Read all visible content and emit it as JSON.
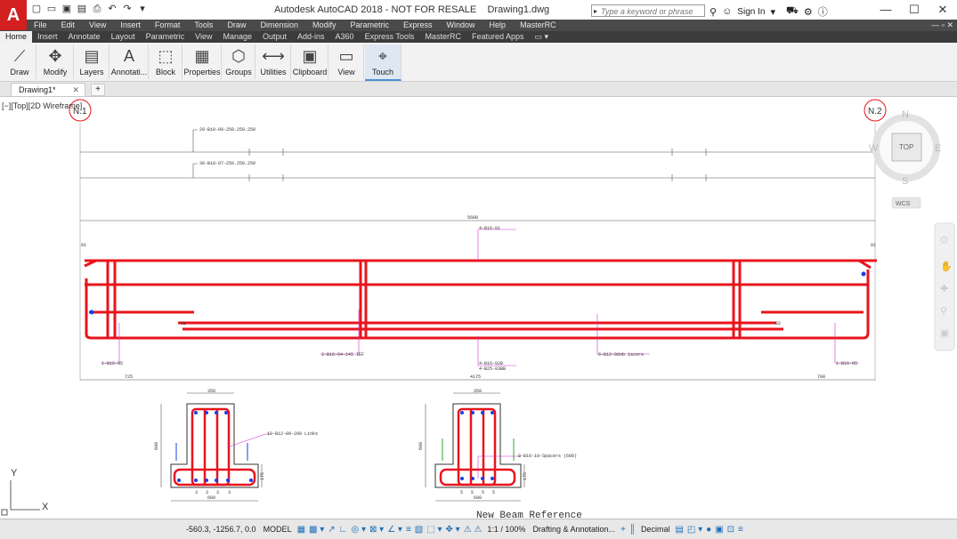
{
  "app": {
    "logo": "A",
    "title": "Autodesk AutoCAD 2018 - NOT FOR RESALE",
    "filename": "Drawing1.dwg"
  },
  "search": {
    "placeholder": "Type a keyword or phrase",
    "signin": "Sign In"
  },
  "menu": [
    "File",
    "Edit",
    "View",
    "Insert",
    "Format",
    "Tools",
    "Draw",
    "Dimension",
    "Modify",
    "Parametric",
    "Express",
    "Window",
    "Help",
    "MasterRC"
  ],
  "ribbon_tabs": [
    "Home",
    "Insert",
    "Annotate",
    "Layout",
    "Parametric",
    "View",
    "Manage",
    "Output",
    "Add-ins",
    "A360",
    "Express Tools",
    "MasterRC",
    "Featured Apps"
  ],
  "ribbon_buttons": [
    "Draw",
    "Modify",
    "Layers",
    "Annotati...",
    "Block",
    "Properties",
    "Groups",
    "Utilities",
    "Clipboard",
    "View",
    "Touch"
  ],
  "doc_tab": {
    "label": "Drawing1*"
  },
  "viewport_label": "[−][Top][2D Wireframe]",
  "viewcube": {
    "n": "N",
    "s": "S",
    "e": "E",
    "w": "W",
    "top": "TOP",
    "wcs": "WCS"
  },
  "drawing": {
    "grid_left": "N.1",
    "grid_right": "N.2",
    "bar_top_label": "20-B10-08-250.250.250",
    "bar_mid_label": "30-B10-07-250.250.250",
    "span_total": "5600",
    "top_bar": "4-B16-01",
    "end_mark_left": "01",
    "end_mark_right": "01",
    "mark_left": "02",
    "mark_right": "02",
    "lbl_left": "1-B16-05",
    "lbl_lower1": "2-B16-04-245  IEF",
    "lbl_lower2a": "4-B16-02B",
    "lbl_lower2b": "4-B25-03BB",
    "lbl_spacers": "6-B12-06nb  iscers",
    "lbl_right": "1-B16-05",
    "dim_left": "725",
    "dim_mid": "4175",
    "dim_right": "700",
    "sec_width": "350",
    "sec_height": "600",
    "sec_flange": "175",
    "sec_base": "600",
    "sec1_label": "19-B12-09-200  Links",
    "sec2_label": "8-B16-10-Spacers (600)",
    "sec_bar_num": "3",
    "sec2_bar_num": "5",
    "caption": "New Beam Reference",
    "ucs_y": "Y",
    "ucs_x": "X"
  },
  "status": {
    "coords": "-560.3, -1256.7, 0.0",
    "model": "MODEL",
    "scale": "1:1 / 100%",
    "workspace": "Drafting & Annotation...",
    "units": "Decimal"
  },
  "colors": {
    "rebar": "#e8141c",
    "leader": "#cc33cc",
    "ribbon_accent": "#4a90d9",
    "logo": "#d21f1f"
  }
}
